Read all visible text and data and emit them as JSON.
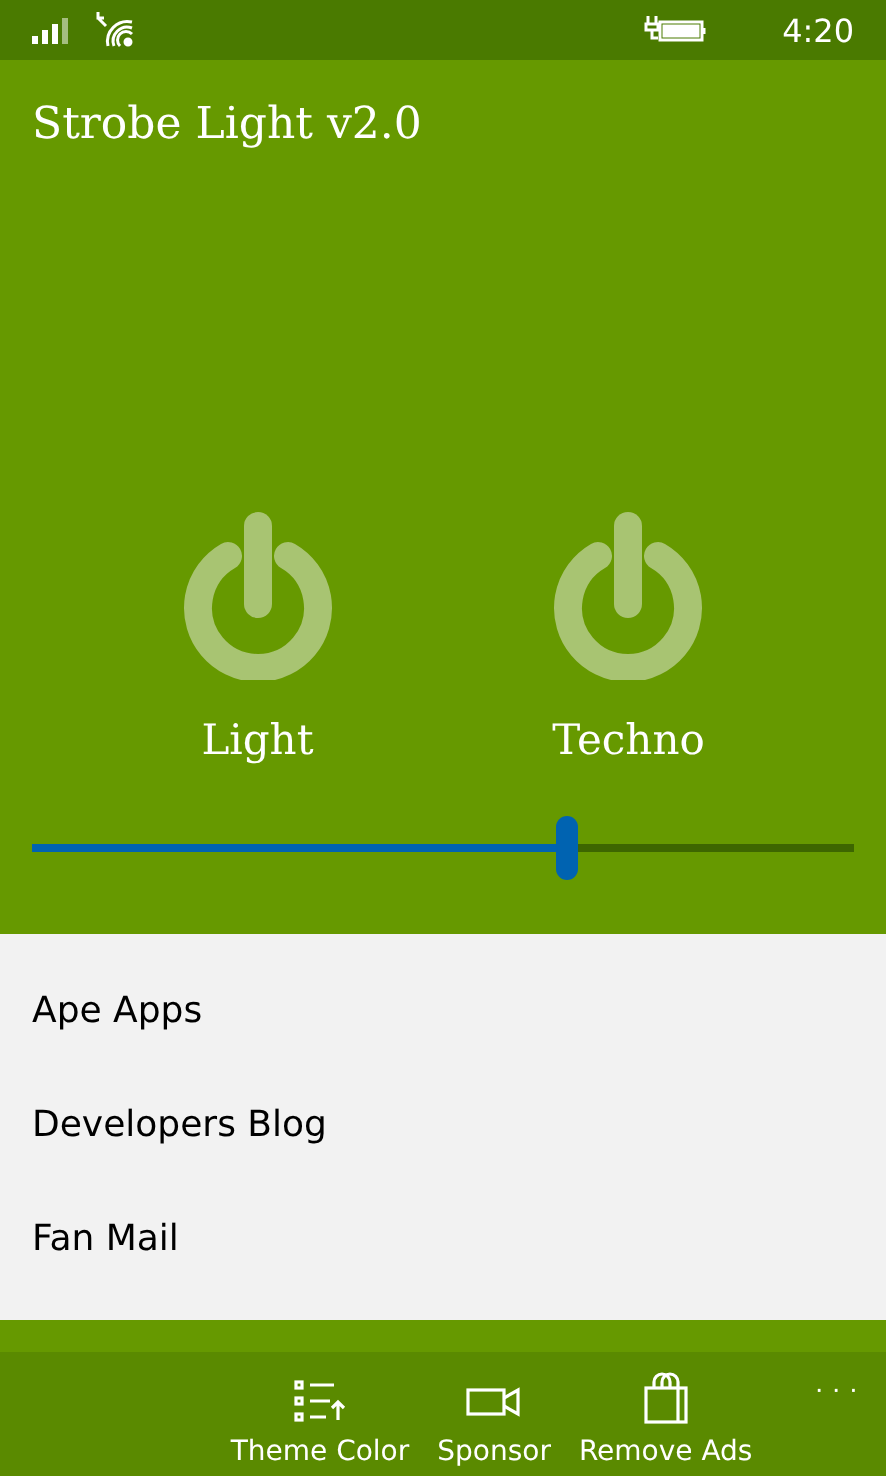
{
  "status_bar": {
    "time": "4:20"
  },
  "title": "Strobe Light v2.0",
  "modes": [
    {
      "label": "Light"
    },
    {
      "label": "Techno"
    }
  ],
  "speed_slider": {
    "level": 0.65
  },
  "links": [
    {
      "label": "Ape Apps"
    },
    {
      "label": "Developers Blog"
    },
    {
      "label": "Fan Mail"
    }
  ],
  "app_bar": {
    "buttons": [
      {
        "kind": "list",
        "label": "Theme Color"
      },
      {
        "kind": "camera",
        "label": "Sponsor"
      },
      {
        "kind": "bag",
        "label": "Remove Ads"
      }
    ],
    "more": "· · ·"
  }
}
